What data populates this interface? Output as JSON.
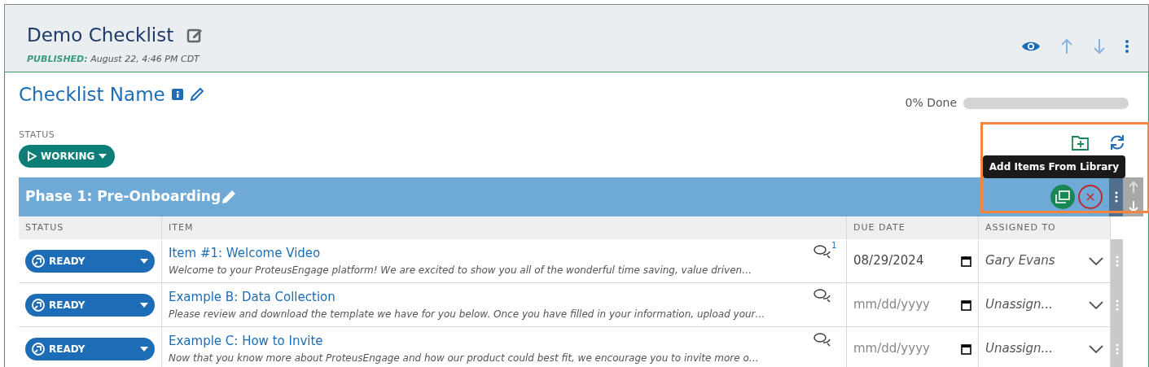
{
  "header": {
    "title": "Demo Checklist",
    "published_label": "PUBLISHED:",
    "published_date": "August 22, 4:46 PM CDT"
  },
  "checklist": {
    "name": "Checklist Name",
    "status_label": "STATUS",
    "status": "WORKING",
    "progress_text": "0% Done",
    "progress": {
      "level": 0
    }
  },
  "tooltip": "Add Items From Library",
  "phase": {
    "title": "Phase 1: Pre-Onboarding",
    "columns": [
      "STATUS",
      "ITEM",
      "DUE DATE",
      "ASSIGNED TO"
    ],
    "rows": [
      {
        "status": "READY",
        "title": "Item #1: Welcome Video",
        "description": "Welcome to your ProteusEngage platform! We are excited to show you all of the wonderful time saving, value driven…",
        "comments": "1",
        "due_date": {
          "value": "08/29/2024"
        },
        "assigned": "Gary Evans"
      },
      {
        "status": "READY",
        "title": "Example B: Data Collection",
        "description": "Please review and download the template we have for you below. Once you have filled in your information, upload your…",
        "due_date": {
          "placeholder": "mm/dd/yyyy"
        },
        "assigned": "Unassign..."
      },
      {
        "status": "READY",
        "title": "Example C: How to Invite",
        "description": "Now that you know more about ProteusEngage and how our product could best fit, we encourage you to invite more o…",
        "due_date": {
          "placeholder": "mm/dd/yyyy"
        },
        "assigned": "Unassign..."
      }
    ]
  }
}
